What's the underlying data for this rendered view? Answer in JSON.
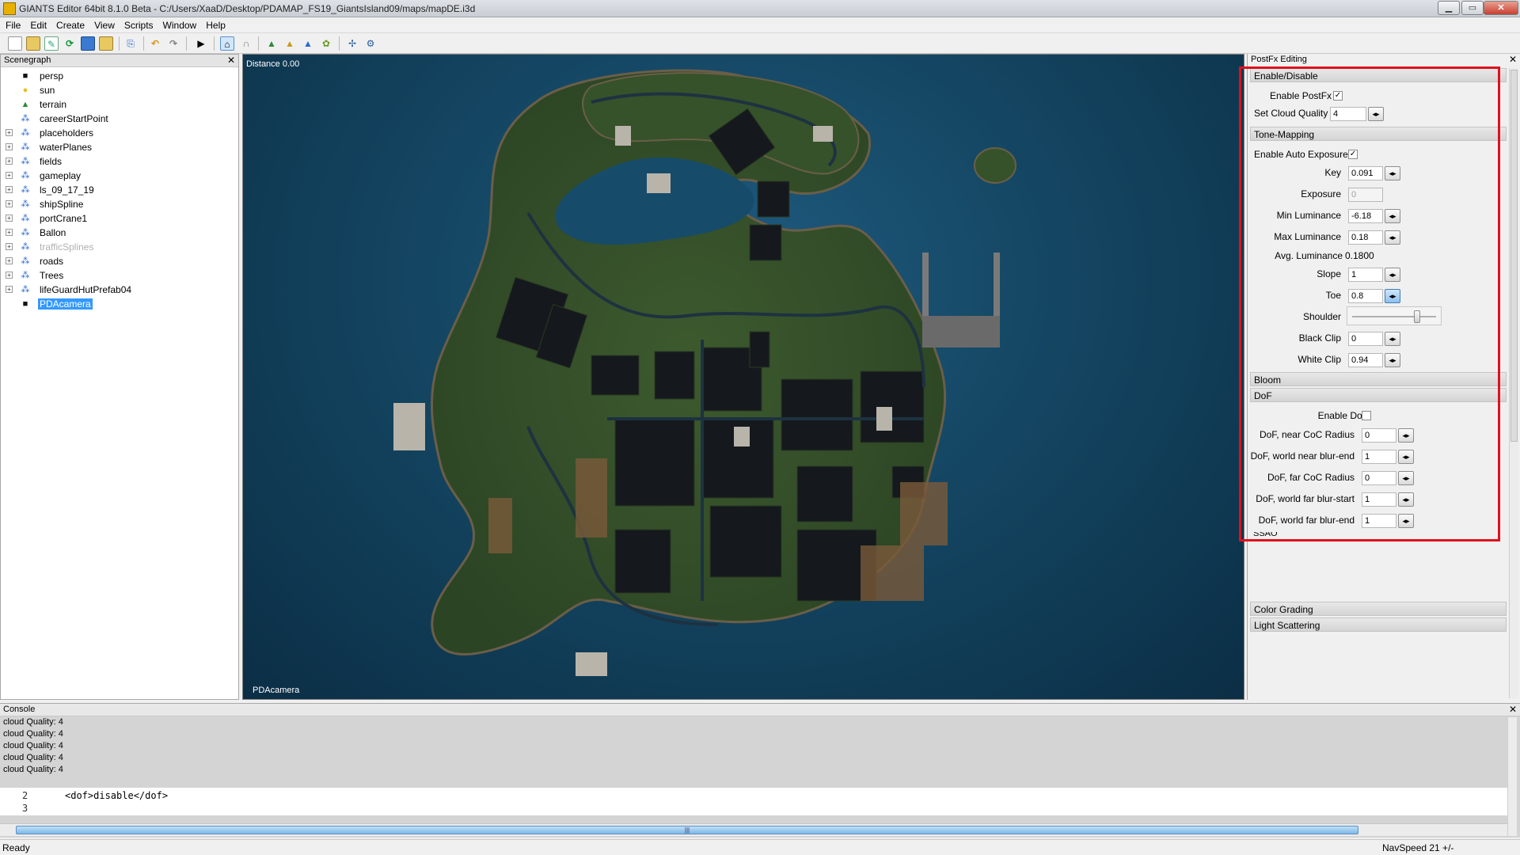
{
  "window": {
    "title": "GIANTS Editor 64bit 8.1.0 Beta - C:/Users/XaaD/Desktop/PDAMAP_FS19_GiantsIsland09/maps/mapDE.i3d",
    "minimize": "▁",
    "maximize": "▭",
    "close": "✕"
  },
  "menu": [
    "File",
    "Edit",
    "Create",
    "View",
    "Scripts",
    "Window",
    "Help"
  ],
  "scenegraph": {
    "title": "Scenegraph",
    "close": "✕",
    "items": [
      {
        "label": "persp",
        "icon": "camera-icon",
        "expandable": false
      },
      {
        "label": "sun",
        "icon": "light-icon",
        "expandable": false
      },
      {
        "label": "terrain",
        "icon": "terrain-icon",
        "expandable": false
      },
      {
        "label": "careerStartPoint",
        "icon": "transform-group-icon",
        "expandable": false
      },
      {
        "label": "placeholders",
        "icon": "transform-group-icon",
        "expandable": true
      },
      {
        "label": "waterPlanes",
        "icon": "transform-group-icon",
        "expandable": true
      },
      {
        "label": "fields",
        "icon": "transform-group-icon",
        "expandable": true
      },
      {
        "label": "gameplay",
        "icon": "transform-group-icon",
        "expandable": true
      },
      {
        "label": "ls_09_17_19",
        "icon": "transform-group-icon",
        "expandable": true
      },
      {
        "label": "shipSpline",
        "icon": "transform-group-icon",
        "expandable": true
      },
      {
        "label": "portCrane1",
        "icon": "transform-group-icon",
        "expandable": true
      },
      {
        "label": "Ballon",
        "icon": "transform-group-icon",
        "expandable": true
      },
      {
        "label": "trafficSplines",
        "icon": "transform-group-icon",
        "expandable": true,
        "dim": true
      },
      {
        "label": "roads",
        "icon": "transform-group-icon",
        "expandable": true
      },
      {
        "label": "Trees",
        "icon": "transform-group-icon",
        "expandable": true
      },
      {
        "label": "lifeGuardHutPrefab04",
        "icon": "transform-group-icon",
        "expandable": true
      },
      {
        "label": "PDAcamera",
        "icon": "camera-icon",
        "expandable": false,
        "selected": true
      }
    ]
  },
  "viewport": {
    "distance": "Distance 0.00",
    "camera": "PDAcamera"
  },
  "postfx": {
    "title": "PostFx Editing",
    "close": "✕",
    "enable_disable": {
      "header": "Enable/Disable",
      "enable_postfx_label": "Enable PostFx",
      "enable_postfx_checked": true,
      "cloud_quality_label": "Set Cloud Quality",
      "cloud_quality_value": "4"
    },
    "tone_mapping": {
      "header": "Tone-Mapping",
      "auto_exposure_label": "Enable Auto Exposure",
      "auto_exposure_checked": true,
      "key_label": "Key",
      "key_value": "0.091",
      "exposure_label": "Exposure",
      "exposure_value": "0",
      "min_lum_label": "Min Luminance",
      "min_lum_value": "-6.18",
      "max_lum_label": "Max Luminance",
      "max_lum_value": "0.18",
      "avg_lum_label": "Avg. Luminance",
      "avg_lum_value": "0.1800",
      "slope_label": "Slope",
      "slope_value": "1",
      "toe_label": "Toe",
      "toe_value": "0.8",
      "shoulder_label": "Shoulder",
      "black_clip_label": "Black Clip",
      "black_clip_value": "0",
      "white_clip_label": "White Clip",
      "white_clip_value": "0.94"
    },
    "bloom": {
      "header": "Bloom"
    },
    "dof": {
      "header": "DoF",
      "enable_label": "Enable DoF",
      "enable_checked": false,
      "near_coc_label": "DoF, near CoC Radius",
      "near_coc_value": "0",
      "world_near_label": "DoF, world near blur-end",
      "world_near_value": "1",
      "far_coc_label": "DoF, far CoC Radius",
      "far_coc_value": "0",
      "world_far_start_label": "DoF, world far blur-start",
      "world_far_start_value": "1",
      "world_far_end_label": "DoF, world far blur-end",
      "world_far_end_value": "1"
    },
    "ssao": {
      "header": "SSAO"
    },
    "color_grading": {
      "header": "Color Grading"
    },
    "light_scattering": {
      "header": "Light Scattering"
    },
    "spin_glyph": "◂▸",
    "check_glyph": "✓"
  },
  "console": {
    "title": "Console",
    "close": "✕",
    "log": [
      "cloud Quality: 4",
      "cloud Quality: 4",
      "cloud Quality: 4",
      "cloud Quality: 4",
      "cloud Quality: 4"
    ],
    "editor_lines": [
      {
        "num": "2",
        "code": "<dof>disable</dof>"
      },
      {
        "num": "3",
        "code": ""
      }
    ],
    "scroll_grip": "|||"
  },
  "status": {
    "left": "Ready",
    "right": "NavSpeed 21 +/-"
  },
  "colors": {
    "highlight_box": "#e0101c",
    "selection": "#3399ff",
    "water": "#154865",
    "land": "#3d5a2e"
  }
}
